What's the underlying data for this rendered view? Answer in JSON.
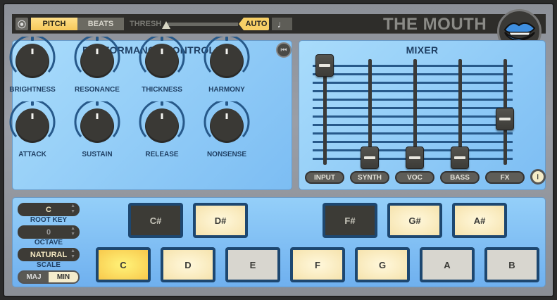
{
  "toolbar": {
    "midi_icon": "midi-icon",
    "pitch_label": "PITCH",
    "beats_label": "BEATS",
    "mode_selected": "PITCH",
    "thresh_label": "THRESH",
    "thresh_value": 0,
    "auto_label": "AUTO",
    "note_icon": "♩",
    "title": "THE MOUTH"
  },
  "performance": {
    "title": "PERFORMANCE CONTROLS",
    "reset_icon": "⏮",
    "knobs": [
      {
        "label": "BRIGHTNESS",
        "value": 0.5
      },
      {
        "label": "RESONANCE",
        "value": 0.5
      },
      {
        "label": "THICKNESS",
        "value": 0.5
      },
      {
        "label": "HARMONY",
        "value": 0.5
      },
      {
        "label": "ATTACK",
        "value": 0.5
      },
      {
        "label": "SUSTAIN",
        "value": 0.5
      },
      {
        "label": "RELEASE",
        "value": 0.5
      },
      {
        "label": "NONSENSE",
        "value": 0.5
      }
    ]
  },
  "mixer": {
    "title": "MIXER",
    "channels": [
      {
        "label": "INPUT",
        "value": 1.0
      },
      {
        "label": "SYNTH",
        "value": 0.0
      },
      {
        "label": "VOC",
        "value": 0.0
      },
      {
        "label": "BASS",
        "value": 0.0
      },
      {
        "label": "FX",
        "value": 0.42
      }
    ],
    "piano_icon": "𝄃"
  },
  "scale": {
    "root_key": "C",
    "root_key_label": "ROOT KEY",
    "octave": "0",
    "octave_label": "OCTAVE",
    "scale": "NATURAL",
    "scale_label": "SCALE",
    "maj_label": "MAJ",
    "min_label": "MIN",
    "mode_selected": "MIN"
  },
  "keys": {
    "black": [
      {
        "label": "C#",
        "state": "dark"
      },
      {
        "label": "D#",
        "state": "on"
      },
      {
        "label": "F#",
        "state": "dark"
      },
      {
        "label": "G#",
        "state": "on"
      },
      {
        "label": "A#",
        "state": "on"
      }
    ],
    "white": [
      {
        "label": "C",
        "state": "active"
      },
      {
        "label": "D",
        "state": "on"
      },
      {
        "label": "E",
        "state": "off"
      },
      {
        "label": "F",
        "state": "on"
      },
      {
        "label": "G",
        "state": "on"
      },
      {
        "label": "A",
        "state": "off"
      },
      {
        "label": "B",
        "state": "off"
      }
    ]
  }
}
